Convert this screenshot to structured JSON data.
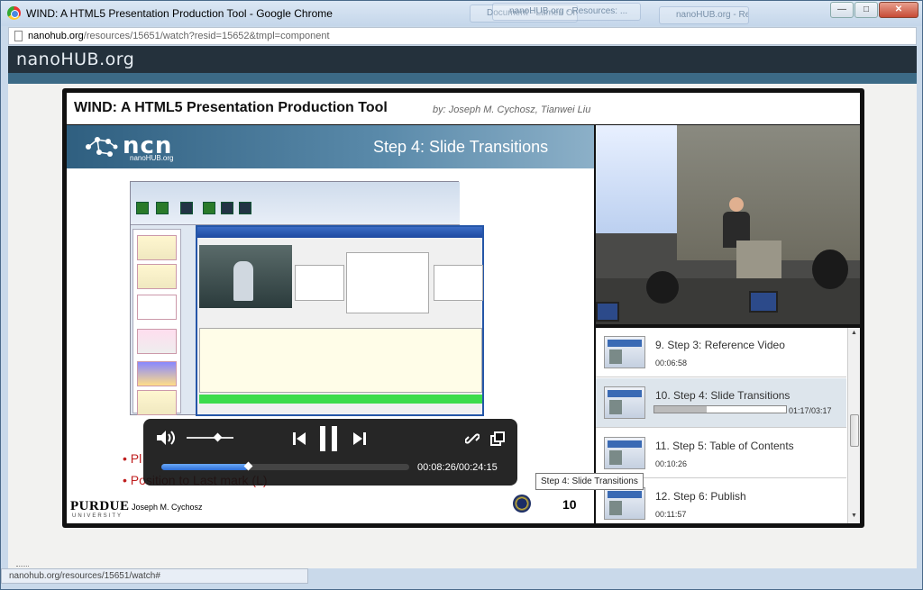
{
  "window": {
    "title": "WIND: A HTML5 Presentation Production Tool - Google Chrome",
    "controls": {
      "minimize": "—",
      "maximize": "□",
      "close": "✕"
    },
    "background_tabs": [
      "Document - Lumen Online Ex",
      "nanoHUB.org - Resources: ...",
      "nanoHUB.org - Resource"
    ]
  },
  "address_bar": {
    "host": "nanohub.org",
    "path": "/resources/15651/watch?resid=15652&tmpl=component"
  },
  "site": {
    "logo": "nanoHUB.org"
  },
  "player": {
    "title": "WIND: A HTML5 Presentation Production Tool",
    "byline": "by: Joseph M. Cychosz, Tianwei Liu",
    "slide": {
      "ncn_logo": "ncn",
      "ncn_sub": "nanoHUB.org",
      "heading": "Step 4: Slide Transitions",
      "bullets": [
        "• Pl",
        "• Position to Last mark (L)"
      ],
      "university": "PURDUE",
      "university_sub": "UNIVERSITY",
      "presenter": "Joseph M. Cychosz",
      "page_number": "10"
    },
    "chapters": [
      {
        "title": "9. Step 3: Reference Video",
        "time": "00:06:58",
        "active": false
      },
      {
        "title": "10. Step 4: Slide Transitions",
        "time": "01:17/03:17",
        "active": true,
        "progress": 0.4
      },
      {
        "title": "11. Step 5: Table of Contents",
        "time": "00:10:26",
        "active": false
      },
      {
        "title": "12. Step 6: Publish",
        "time": "00:11:57",
        "active": false
      }
    ],
    "controls": {
      "volume_icon": "speaker-icon",
      "volume_level": 0.65,
      "prev_icon": "skip-back-icon",
      "pause_icon": "pause-icon",
      "next_icon": "skip-forward-icon",
      "link_icon": "link-icon",
      "popout_icon": "popout-icon",
      "seek_progress": 0.35,
      "time": "00:08:26/00:24:15"
    },
    "tooltip": "Step 4: Slide Transitions"
  },
  "status_bar": {
    "text": "nanohub.org/resources/15651/watch#"
  }
}
